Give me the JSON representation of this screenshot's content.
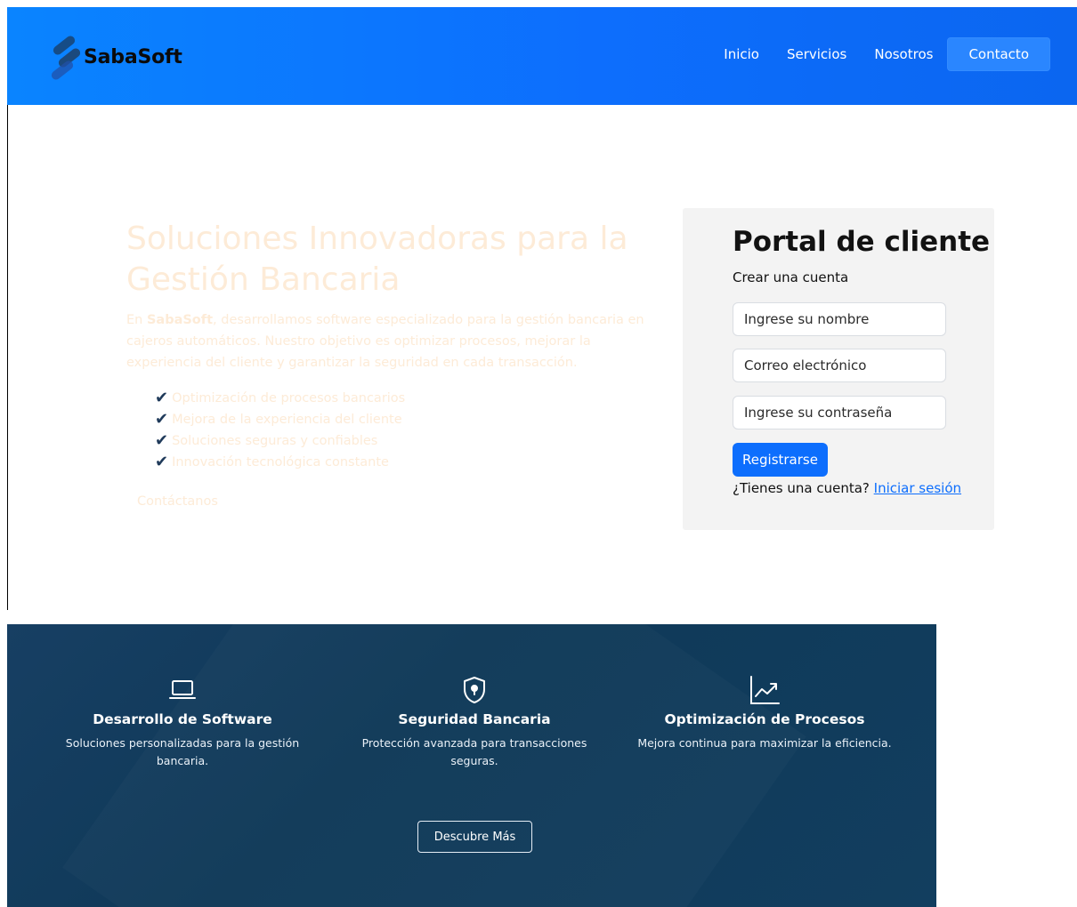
{
  "brand": {
    "name": "SabaSoft"
  },
  "nav": {
    "items": [
      "Inicio",
      "Servicios",
      "Nosotros"
    ],
    "contact": "Contacto"
  },
  "hero": {
    "title": "Soluciones Innovadoras para la Gestión Bancaria",
    "desc_prefix": "En ",
    "desc_brand": "SabaSoft",
    "desc_rest": ", desarrollamos software especializado para la gestión bancaria en cajeros automáticos. Nuestro objetivo es optimizar procesos, mejorar la experiencia del cliente y garantizar la seguridad en cada transacción.",
    "features": [
      "Optimización de procesos bancarios",
      "Mejora de la experiencia del cliente",
      "Soluciones seguras y confiables",
      "Innovación tecnológica constante"
    ],
    "check_glyph": "✔",
    "cta": "Contáctanos"
  },
  "portal": {
    "title": "Portal de cliente",
    "subtitle": "Crear una cuenta",
    "name_placeholder": "Ingrese su nombre",
    "email_placeholder": "Correo electrónico",
    "password_placeholder": "Ingrese su contraseña",
    "register": "Registrarse",
    "have_account": "¿Tienes una cuenta?",
    "login": "Iniciar sesión"
  },
  "services": {
    "items": [
      {
        "icon": "laptop-icon",
        "title": "Desarrollo de Software",
        "desc": "Soluciones personalizadas para la gestión bancaria."
      },
      {
        "icon": "shield-keyhole-icon",
        "title": "Seguridad Bancaria",
        "desc": "Protección avanzada para transacciones seguras."
      },
      {
        "icon": "trending-up-chart-icon",
        "title": "Optimización de Procesos",
        "desc": "Mejora continua para maximizar la eficiencia."
      }
    ],
    "more": "Descubre Más"
  },
  "colors": {
    "header_blue": "#0d6efd",
    "hero_text": "#fdebd7",
    "services_bg": "#123e5f"
  }
}
